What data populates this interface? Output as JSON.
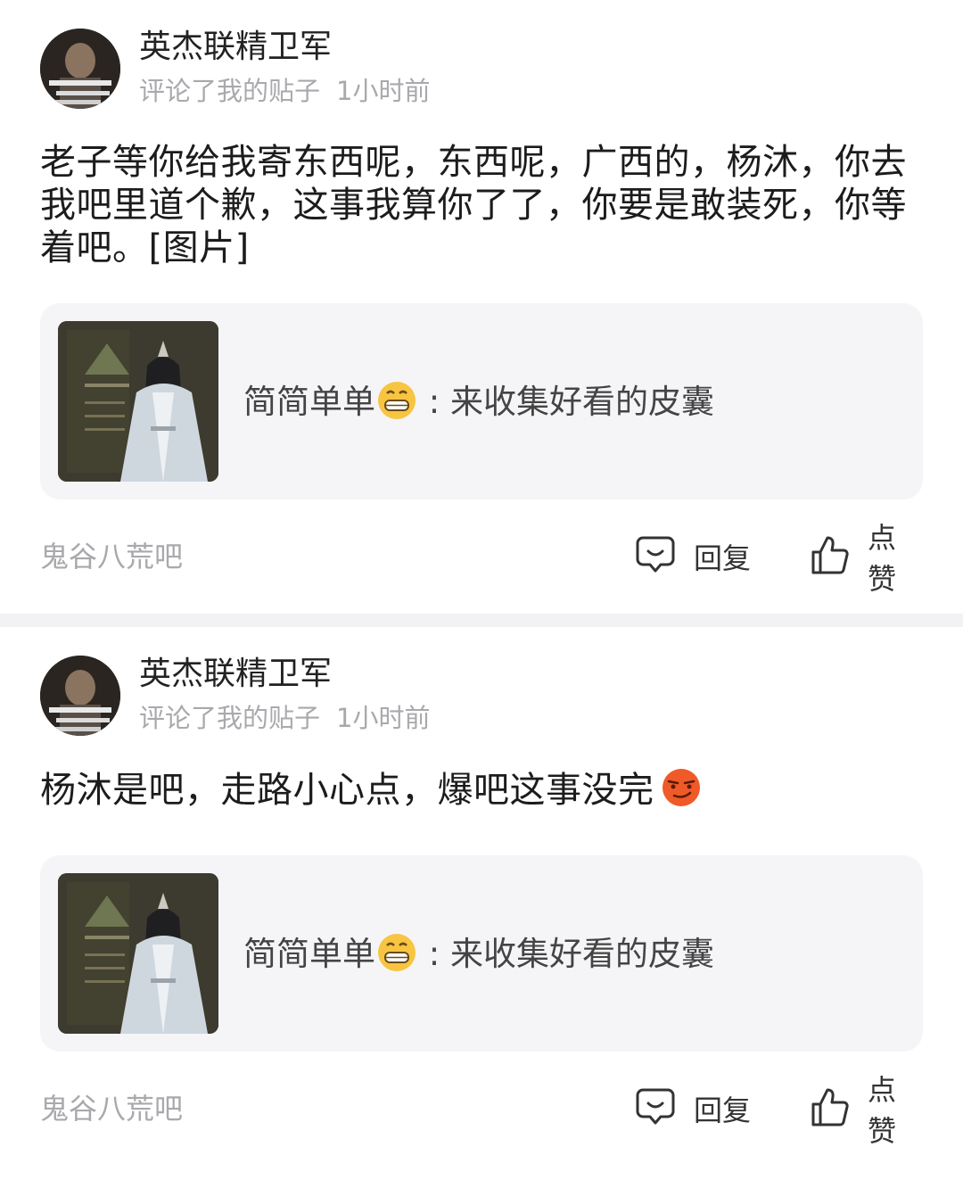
{
  "posts": [
    {
      "author": "英杰联精卫军",
      "action": "评论了我的贴子",
      "time": "1小时前",
      "content": "老子等你给我寄东西呢，东西呢，广西的，杨沐，你去我吧里道个歉，这事我算你了了，你要是敢装死，你等着吧。[图片]",
      "quote": {
        "author": "简简单单",
        "separator": " : ",
        "text": "来收集好看的皮囊"
      },
      "forum": "鬼谷八荒吧",
      "reply_label": "回复",
      "like_label": "点赞"
    },
    {
      "author": "英杰联精卫军",
      "action": "评论了我的贴子",
      "time": "1小时前",
      "content": "杨沐是吧，走路小心点，爆吧这事没完",
      "quote": {
        "author": "简简单单",
        "separator": " : ",
        "text": "来收集好看的皮囊"
      },
      "forum": "鬼谷八荒吧",
      "reply_label": "回复",
      "like_label": "点赞"
    }
  ],
  "icons": {
    "reply": "comment-bubble-icon",
    "like": "thumbs-up-icon",
    "quote_emoji": "grinning-face-icon",
    "content_emoji": "smirk-face-icon"
  },
  "colors": {
    "secondary_text": "#a9a9ad",
    "quote_bg": "#f5f5f8",
    "divider": "#f2f2f4"
  }
}
